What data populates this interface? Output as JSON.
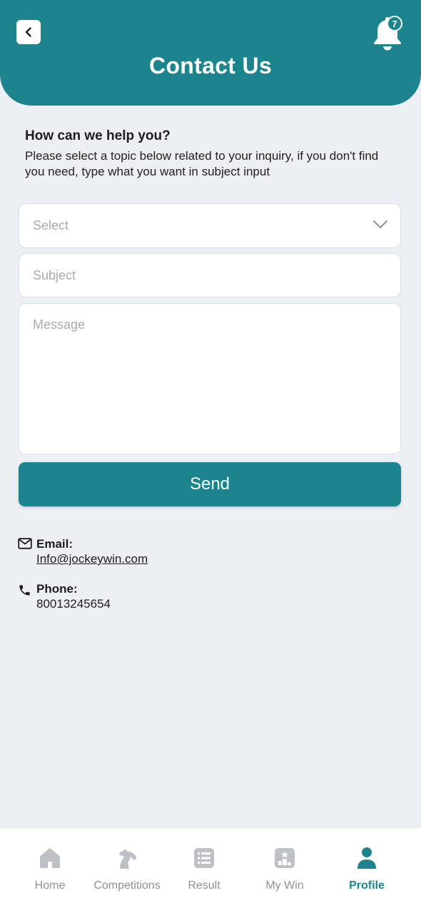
{
  "header": {
    "title": "Contact Us",
    "notification_count": "7"
  },
  "help": {
    "heading": "How can we help you?",
    "description": "Please select a topic below related to your inquiry, if you don't find you need, type what you want in subject input"
  },
  "form": {
    "select_placeholder": "Select",
    "subject_placeholder": "Subject",
    "message_placeholder": "Message",
    "send_label": "Send"
  },
  "contact": {
    "email_label": "Email:",
    "email_value": "Info@jockeywin.com",
    "phone_label": "Phone:",
    "phone_value": "80013245654"
  },
  "nav": {
    "items": [
      {
        "label": "Home",
        "icon": "home-icon",
        "active": false
      },
      {
        "label": "Competitions",
        "icon": "horse-icon",
        "active": false
      },
      {
        "label": "Result",
        "icon": "list-icon",
        "active": false
      },
      {
        "label": "My Win",
        "icon": "trophy-icon",
        "active": false
      },
      {
        "label": "Profile",
        "icon": "user-icon",
        "active": true
      }
    ]
  },
  "colors": {
    "primary": "#1C848C",
    "background": "#ECEFF3",
    "inactive_nav": "#8D9196"
  }
}
